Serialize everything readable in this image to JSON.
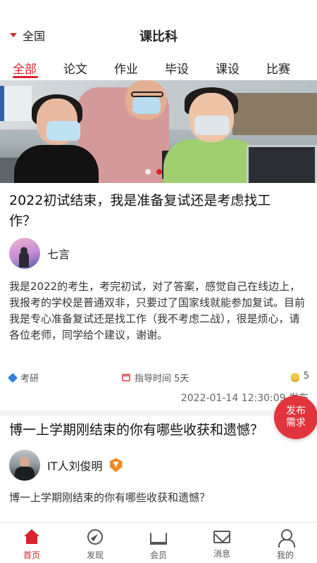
{
  "header": {
    "location": "全国",
    "title": "课比科"
  },
  "tabs": [
    {
      "label": "全部",
      "active": true
    },
    {
      "label": "论文"
    },
    {
      "label": "作业"
    },
    {
      "label": "毕设"
    },
    {
      "label": "课设"
    },
    {
      "label": "比赛"
    }
  ],
  "banner": {
    "pages": 2,
    "current_page": 2
  },
  "posts": [
    {
      "title": "2022初试结束，我是准备复试还是考虑找工作？",
      "author": "七言",
      "body": "我是2022的考生，考完初试，对了答案，感觉自己在线边上，我报考的学校是普通双非，只要过了国家线就能参加复试。目前我是专心准备复试还是找工作（我不考虑二战），很是烦心，请各位老师，同学给个建议，谢谢。",
      "tag": "考研",
      "guide_time": "指导时间 5天",
      "coins": "5",
      "time": "2022-01-14 12:30:09 发布"
    },
    {
      "title": "博一上学期刚结束的你有哪些收获和遗憾？",
      "author": "IT人刘俊明",
      "body": "博一上学期刚结束的你有哪些收获和遗憾？"
    }
  ],
  "fab": {
    "line1": "发布",
    "line2": "需求"
  },
  "bottom_nav": [
    {
      "label": "首页",
      "icon": "home-icon",
      "active": true
    },
    {
      "label": "发现",
      "icon": "compass-icon"
    },
    {
      "label": "会员",
      "icon": "crown-icon"
    },
    {
      "label": "消息",
      "icon": "mail-icon"
    },
    {
      "label": "我的",
      "icon": "user-icon"
    }
  ],
  "colors": {
    "accent": "#d8242c",
    "fab": "#e2343d"
  }
}
